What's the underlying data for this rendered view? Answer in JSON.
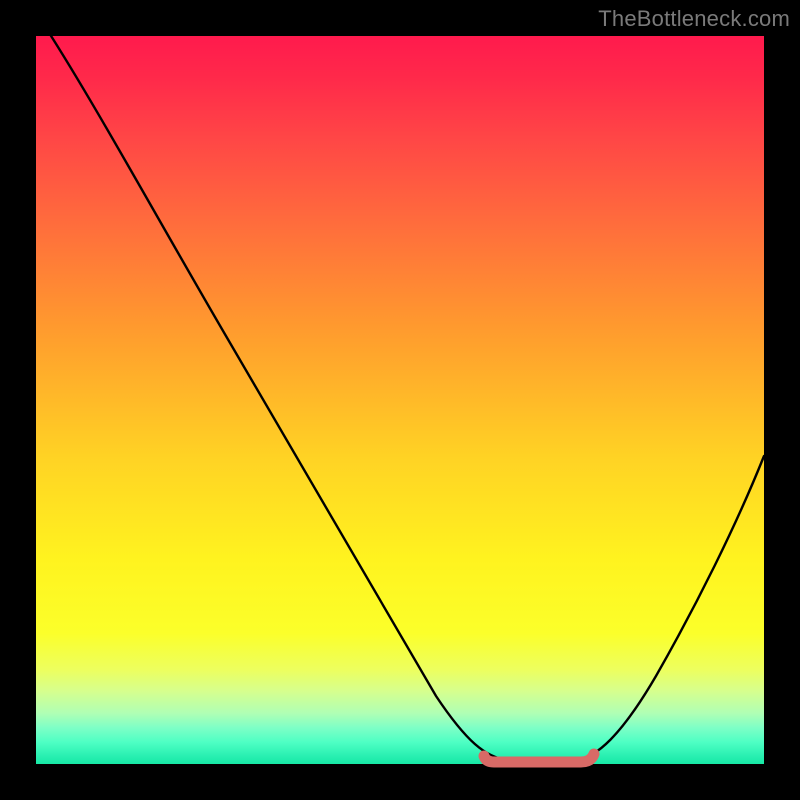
{
  "watermark": "TheBottleneck.com",
  "chart_data": {
    "type": "line",
    "title": "",
    "xlabel": "",
    "ylabel": "",
    "xlim": [
      0,
      100
    ],
    "ylim": [
      0,
      100
    ],
    "grid": false,
    "legend": false,
    "background_gradient": {
      "top": "#ff1a4d",
      "mid": "#fff31f",
      "bottom": "#17e9a6"
    },
    "series": [
      {
        "name": "bottleneck-curve",
        "color": "#000000",
        "x": [
          0,
          5,
          10,
          15,
          20,
          25,
          30,
          35,
          40,
          45,
          50,
          55,
          60,
          63,
          66,
          70,
          73,
          76,
          80,
          85,
          90,
          95,
          100
        ],
        "y": [
          100,
          92,
          84,
          76,
          68,
          60,
          52,
          44,
          36,
          28,
          20,
          13,
          7,
          3,
          1,
          0,
          0,
          1,
          4,
          11,
          21,
          33,
          47
        ]
      },
      {
        "name": "optimal-range-marker",
        "color": "#d86a66",
        "x": [
          62,
          77
        ],
        "y": [
          0.5,
          0.5
        ]
      }
    ],
    "annotations": []
  }
}
